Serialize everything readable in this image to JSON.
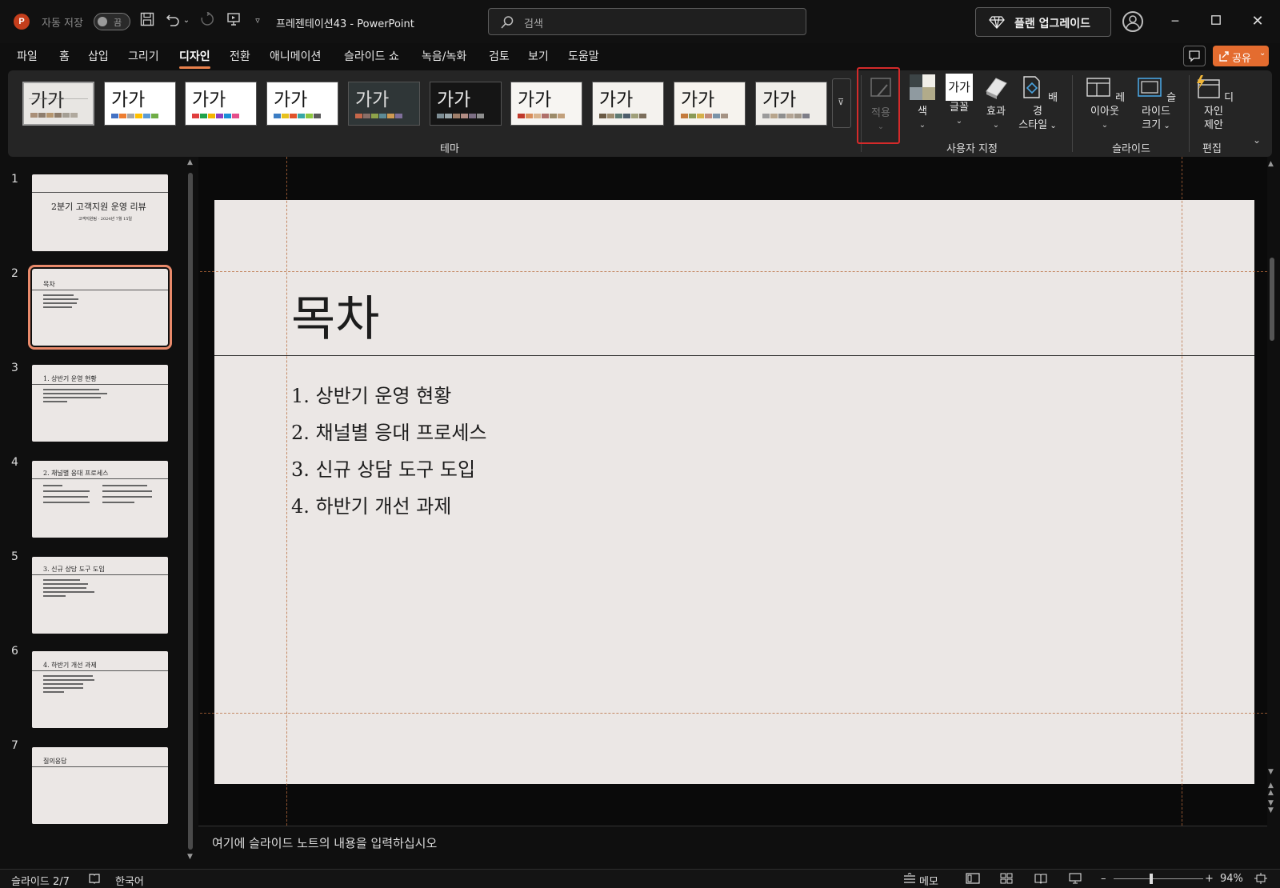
{
  "titlebar": {
    "autosave_label": "자동 저장",
    "autosave_state": "끔",
    "document_title": "프레젠테이션43  -  PowerPoint",
    "search_placeholder": "검색",
    "upgrade_label": "플랜 업그레이드"
  },
  "menu": {
    "tabs": [
      "파일",
      "홈",
      "삽입",
      "그리기",
      "디자인",
      "전환",
      "애니메이션",
      "슬라이드 쇼",
      "녹음/녹화",
      "검토",
      "보기",
      "도움말"
    ],
    "active_tab": "디자인",
    "share_label": "공유"
  },
  "ribbon": {
    "theme_sample_text": "가가",
    "theme_group_label": "테마",
    "customize_group_label": "사용자 지정",
    "slide_group_label": "슬라이드",
    "edit_group_label": "편집",
    "apply_label": "적용",
    "color_label": "색",
    "font_label": "글꼴",
    "font_sample": "가가",
    "effect_label": "효과",
    "background_label_1": "배경",
    "background_label_2": "스타일",
    "layout_label": "레이아웃",
    "slide_size_label_1": "슬라이드",
    "slide_size_label_2": "크기",
    "designer_label_1": "디자인",
    "designer_label_2": "제안"
  },
  "thumbnails": [
    {
      "num": "1",
      "title": "2분기 고객지원 운영 리뷰",
      "subtitle": "고객지원팀 · 2024년 7월 15일"
    },
    {
      "num": "2",
      "title": "목차"
    },
    {
      "num": "3",
      "title": "1. 상반기 운영 현황"
    },
    {
      "num": "4",
      "title": "2. 채널별 응대 프로세스"
    },
    {
      "num": "5",
      "title": "3. 신규 상담 도구 도입"
    },
    {
      "num": "6",
      "title": "4. 하반기 개선 과제"
    },
    {
      "num": "7",
      "title": "질의응답"
    }
  ],
  "slide": {
    "title": "목차",
    "items": [
      "1. 상반기 운영 현황",
      "2. 채널별 응대 프로세스",
      "3. 신규 상담 도구 도입",
      "4. 하반기 개선 과제"
    ]
  },
  "notes": {
    "placeholder": "여기에 슬라이드 노트의 내용을 입력하십시오"
  },
  "status": {
    "slide_count": "슬라이드 2/7",
    "language": "한국어",
    "notes_label": "메모",
    "zoom": "94%"
  },
  "colors": {
    "accent": "#e8804b",
    "share": "#e46c2f",
    "highlight_box": "#d42a2a",
    "slide_bg": "#ebe7e5"
  }
}
